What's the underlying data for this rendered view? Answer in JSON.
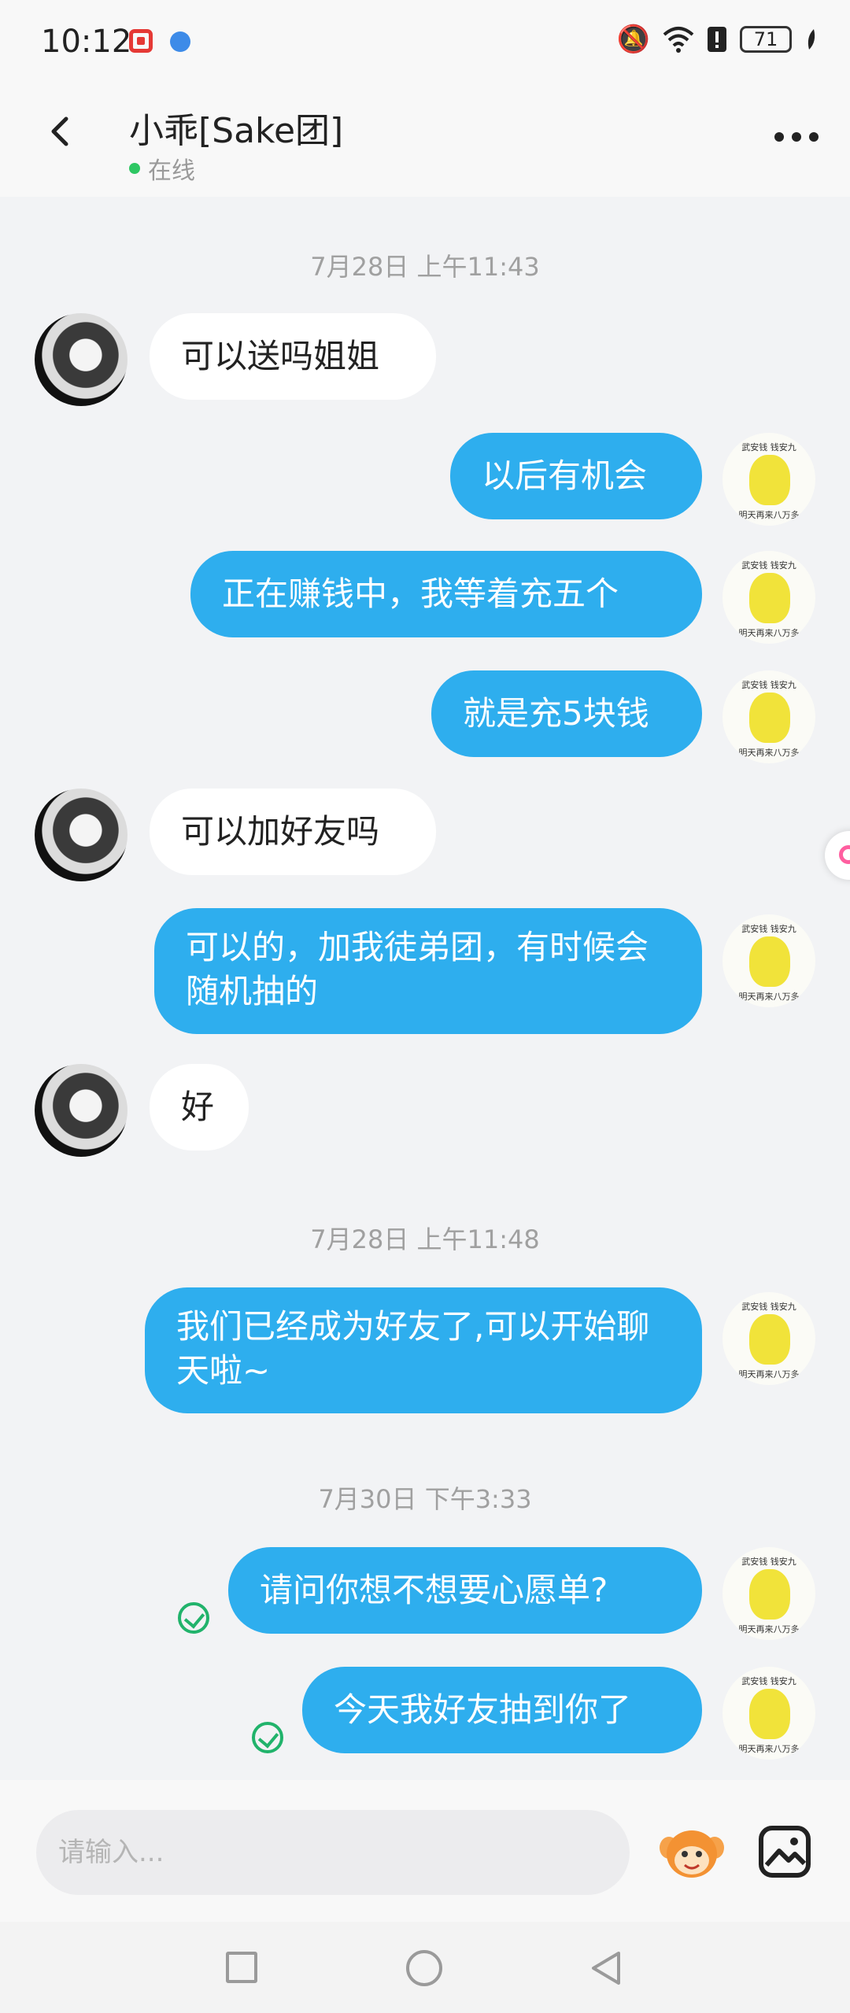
{
  "status_bar": {
    "time": "10:12",
    "battery": "71"
  },
  "header": {
    "title": "小乖[Sake团]",
    "status": "在线"
  },
  "chat": {
    "timestamps": [
      "7月28日 上午11:43",
      "7月28日 上午11:48",
      "7月30日 下午3:33"
    ],
    "messages": [
      {
        "side": "left",
        "text": "可以送吗姐姐"
      },
      {
        "side": "right",
        "text": "以后有机会"
      },
      {
        "side": "right",
        "text": "正在赚钱中，我等着充五个"
      },
      {
        "side": "right",
        "text": "就是充5块钱"
      },
      {
        "side": "left",
        "text": "可以加好友吗"
      },
      {
        "side": "right",
        "text": "可以的，加我徒弟团，有时候会随机抽的"
      },
      {
        "side": "left",
        "text": "好"
      },
      {
        "side": "right",
        "text": "我们已经成为好友了,可以开始聊天啦~"
      },
      {
        "side": "right",
        "text": "请问你想不想要心愿单?",
        "read": true
      },
      {
        "side": "right",
        "text": "今天我好友抽到你了",
        "read": true
      }
    ],
    "sticker_text": {
      "top": "武安钱 钱安九",
      "bottom": "明天再来八万多"
    }
  },
  "input": {
    "placeholder": "请输入..."
  },
  "colors": {
    "bubble_right": "#2eaeee",
    "bubble_left": "#ffffff",
    "online_dot": "#2ec763",
    "read_check": "#21b36b"
  }
}
